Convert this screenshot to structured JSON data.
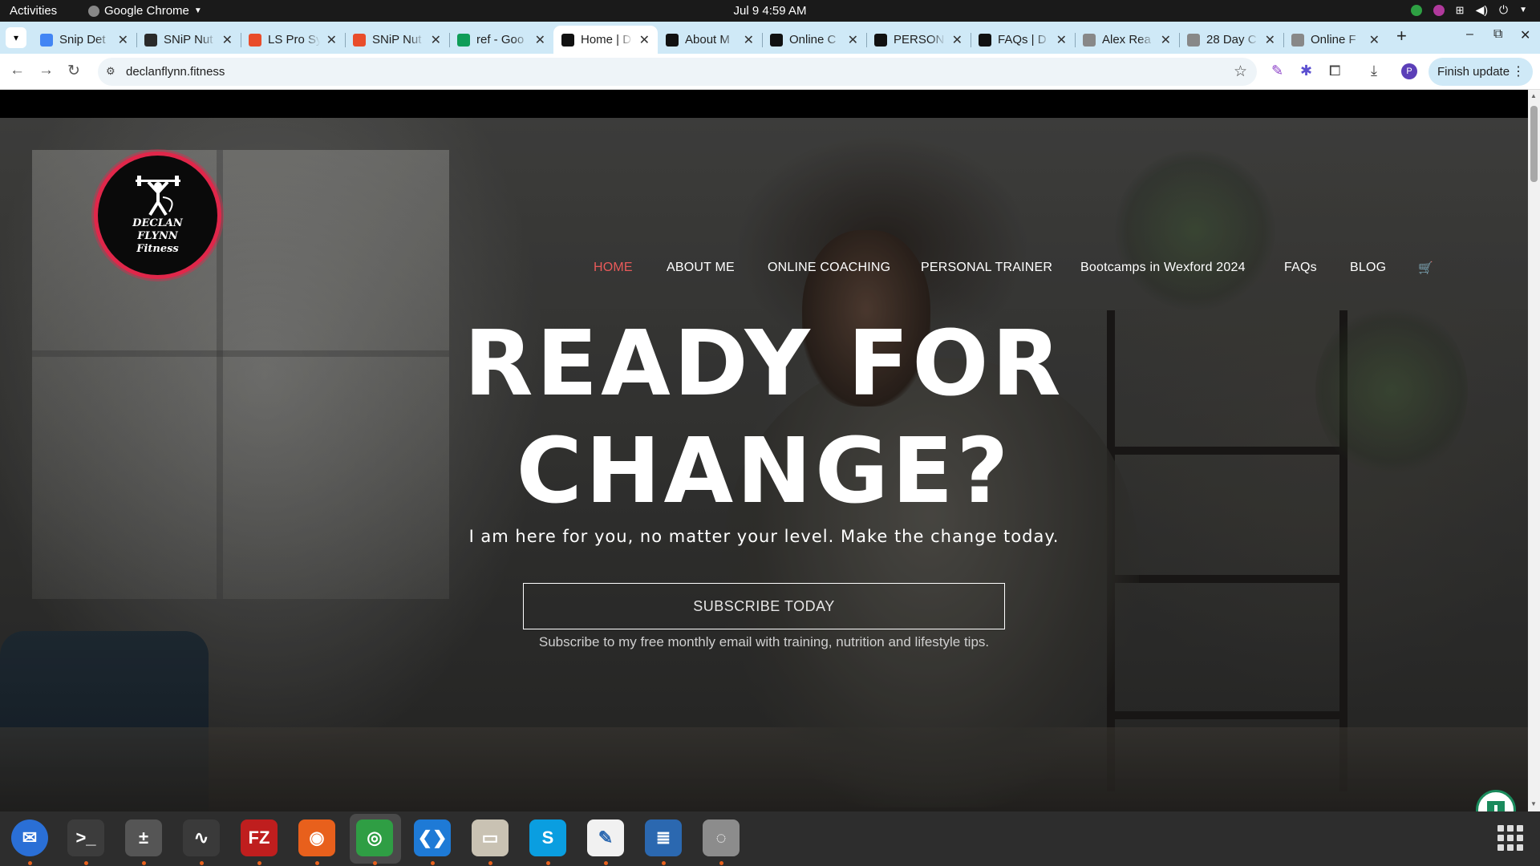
{
  "system_bar": {
    "activities": "Activities",
    "app_name": "Google Chrome",
    "clock": "Jul 9  4:59 AM"
  },
  "browser": {
    "tabs": [
      {
        "title": "Snip Det",
        "icon": "google-docs-icon",
        "color": "#4285f4",
        "active": false
      },
      {
        "title": "SNiP Nut",
        "icon": "snip-nutrition-icon",
        "color": "#2a2a2a",
        "active": false
      },
      {
        "title": "LS Pro Sy",
        "icon": "ls-pro-icon",
        "color": "#e94d2b",
        "active": false
      },
      {
        "title": "SNiP Nut",
        "icon": "snip-nutrition-icon",
        "color": "#e94d2b",
        "active": false
      },
      {
        "title": "ref - Goo",
        "icon": "google-sheets-icon",
        "color": "#0f9d58",
        "active": false
      },
      {
        "title": "Home | D",
        "icon": "declan-flynn-icon",
        "color": "#111111",
        "active": true
      },
      {
        "title": "About M",
        "icon": "declan-flynn-icon",
        "color": "#111111",
        "active": false
      },
      {
        "title": "Online C",
        "icon": "declan-flynn-icon",
        "color": "#111111",
        "active": false
      },
      {
        "title": "PERSON",
        "icon": "declan-flynn-icon",
        "color": "#111111",
        "active": false
      },
      {
        "title": "FAQs | D",
        "icon": "declan-flynn-icon",
        "color": "#111111",
        "active": false
      },
      {
        "title": "Alex Rea",
        "icon": "webpage-icon",
        "color": "#888888",
        "active": false
      },
      {
        "title": "28 Day C",
        "icon": "webpage-icon",
        "color": "#888888",
        "active": false
      },
      {
        "title": "Online F",
        "icon": "webpage-icon",
        "color": "#888888",
        "active": false
      }
    ],
    "url": "declanflynn.fitness",
    "finish_update": "Finish update",
    "profile_initial": "P"
  },
  "site": {
    "logo_text": [
      "DECLAN",
      "FLYNN",
      "Fitness"
    ],
    "nav": [
      {
        "label": "HOME",
        "active": true
      },
      {
        "label": "ABOUT ME",
        "active": false
      },
      {
        "label": "ONLINE COACHING",
        "active": false
      },
      {
        "label": "PERSONAL TRAINER",
        "active": false
      },
      {
        "label": "Bootcamps in Wexford 2024",
        "active": false
      },
      {
        "label": "FAQs",
        "active": false
      },
      {
        "label": "BLOG",
        "active": false
      },
      {
        "label": "",
        "icon": "cart-icon",
        "active": false
      }
    ],
    "hero": {
      "title_line1": "READY FOR",
      "title_line2": "CHANGE?",
      "subtitle": "I am here for you, no matter your level. Make the change today.",
      "cta": "SUBSCRIBE TODAY",
      "note": "Subscribe to my free monthly email with training, nutrition and lifestyle tips."
    },
    "accent_color": "#e0274a",
    "active_nav_color": "#e85a5a"
  },
  "dock": {
    "apps": [
      {
        "name": "thunderbird-icon",
        "color": "#2a6fd6",
        "glyph": "✉"
      },
      {
        "name": "terminal-icon",
        "color": "#3c3c3c",
        "glyph": ">_"
      },
      {
        "name": "calculator-icon",
        "color": "#555555",
        "glyph": "±"
      },
      {
        "name": "system-monitor-icon",
        "color": "#3a3a3a",
        "glyph": "∿"
      },
      {
        "name": "filezilla-icon",
        "color": "#bf1e1e",
        "glyph": "FZ"
      },
      {
        "name": "firefox-icon",
        "color": "#e8601c",
        "glyph": "◉"
      },
      {
        "name": "chrome-icon",
        "color": "#2f9e44",
        "glyph": "◎"
      },
      {
        "name": "vscode-icon",
        "color": "#1e7ad6",
        "glyph": "❮❯"
      },
      {
        "name": "files-icon",
        "color": "#c9c2b3",
        "glyph": "▭"
      },
      {
        "name": "skype-icon",
        "color": "#0a9ee0",
        "glyph": "S"
      },
      {
        "name": "text-editor-icon",
        "color": "#f1f1f1",
        "glyph": "✎"
      },
      {
        "name": "libreoffice-writer-icon",
        "color": "#2b68b0",
        "glyph": "≣"
      },
      {
        "name": "disk-utility-icon",
        "color": "#8c8c8c",
        "glyph": "◌"
      }
    ]
  }
}
